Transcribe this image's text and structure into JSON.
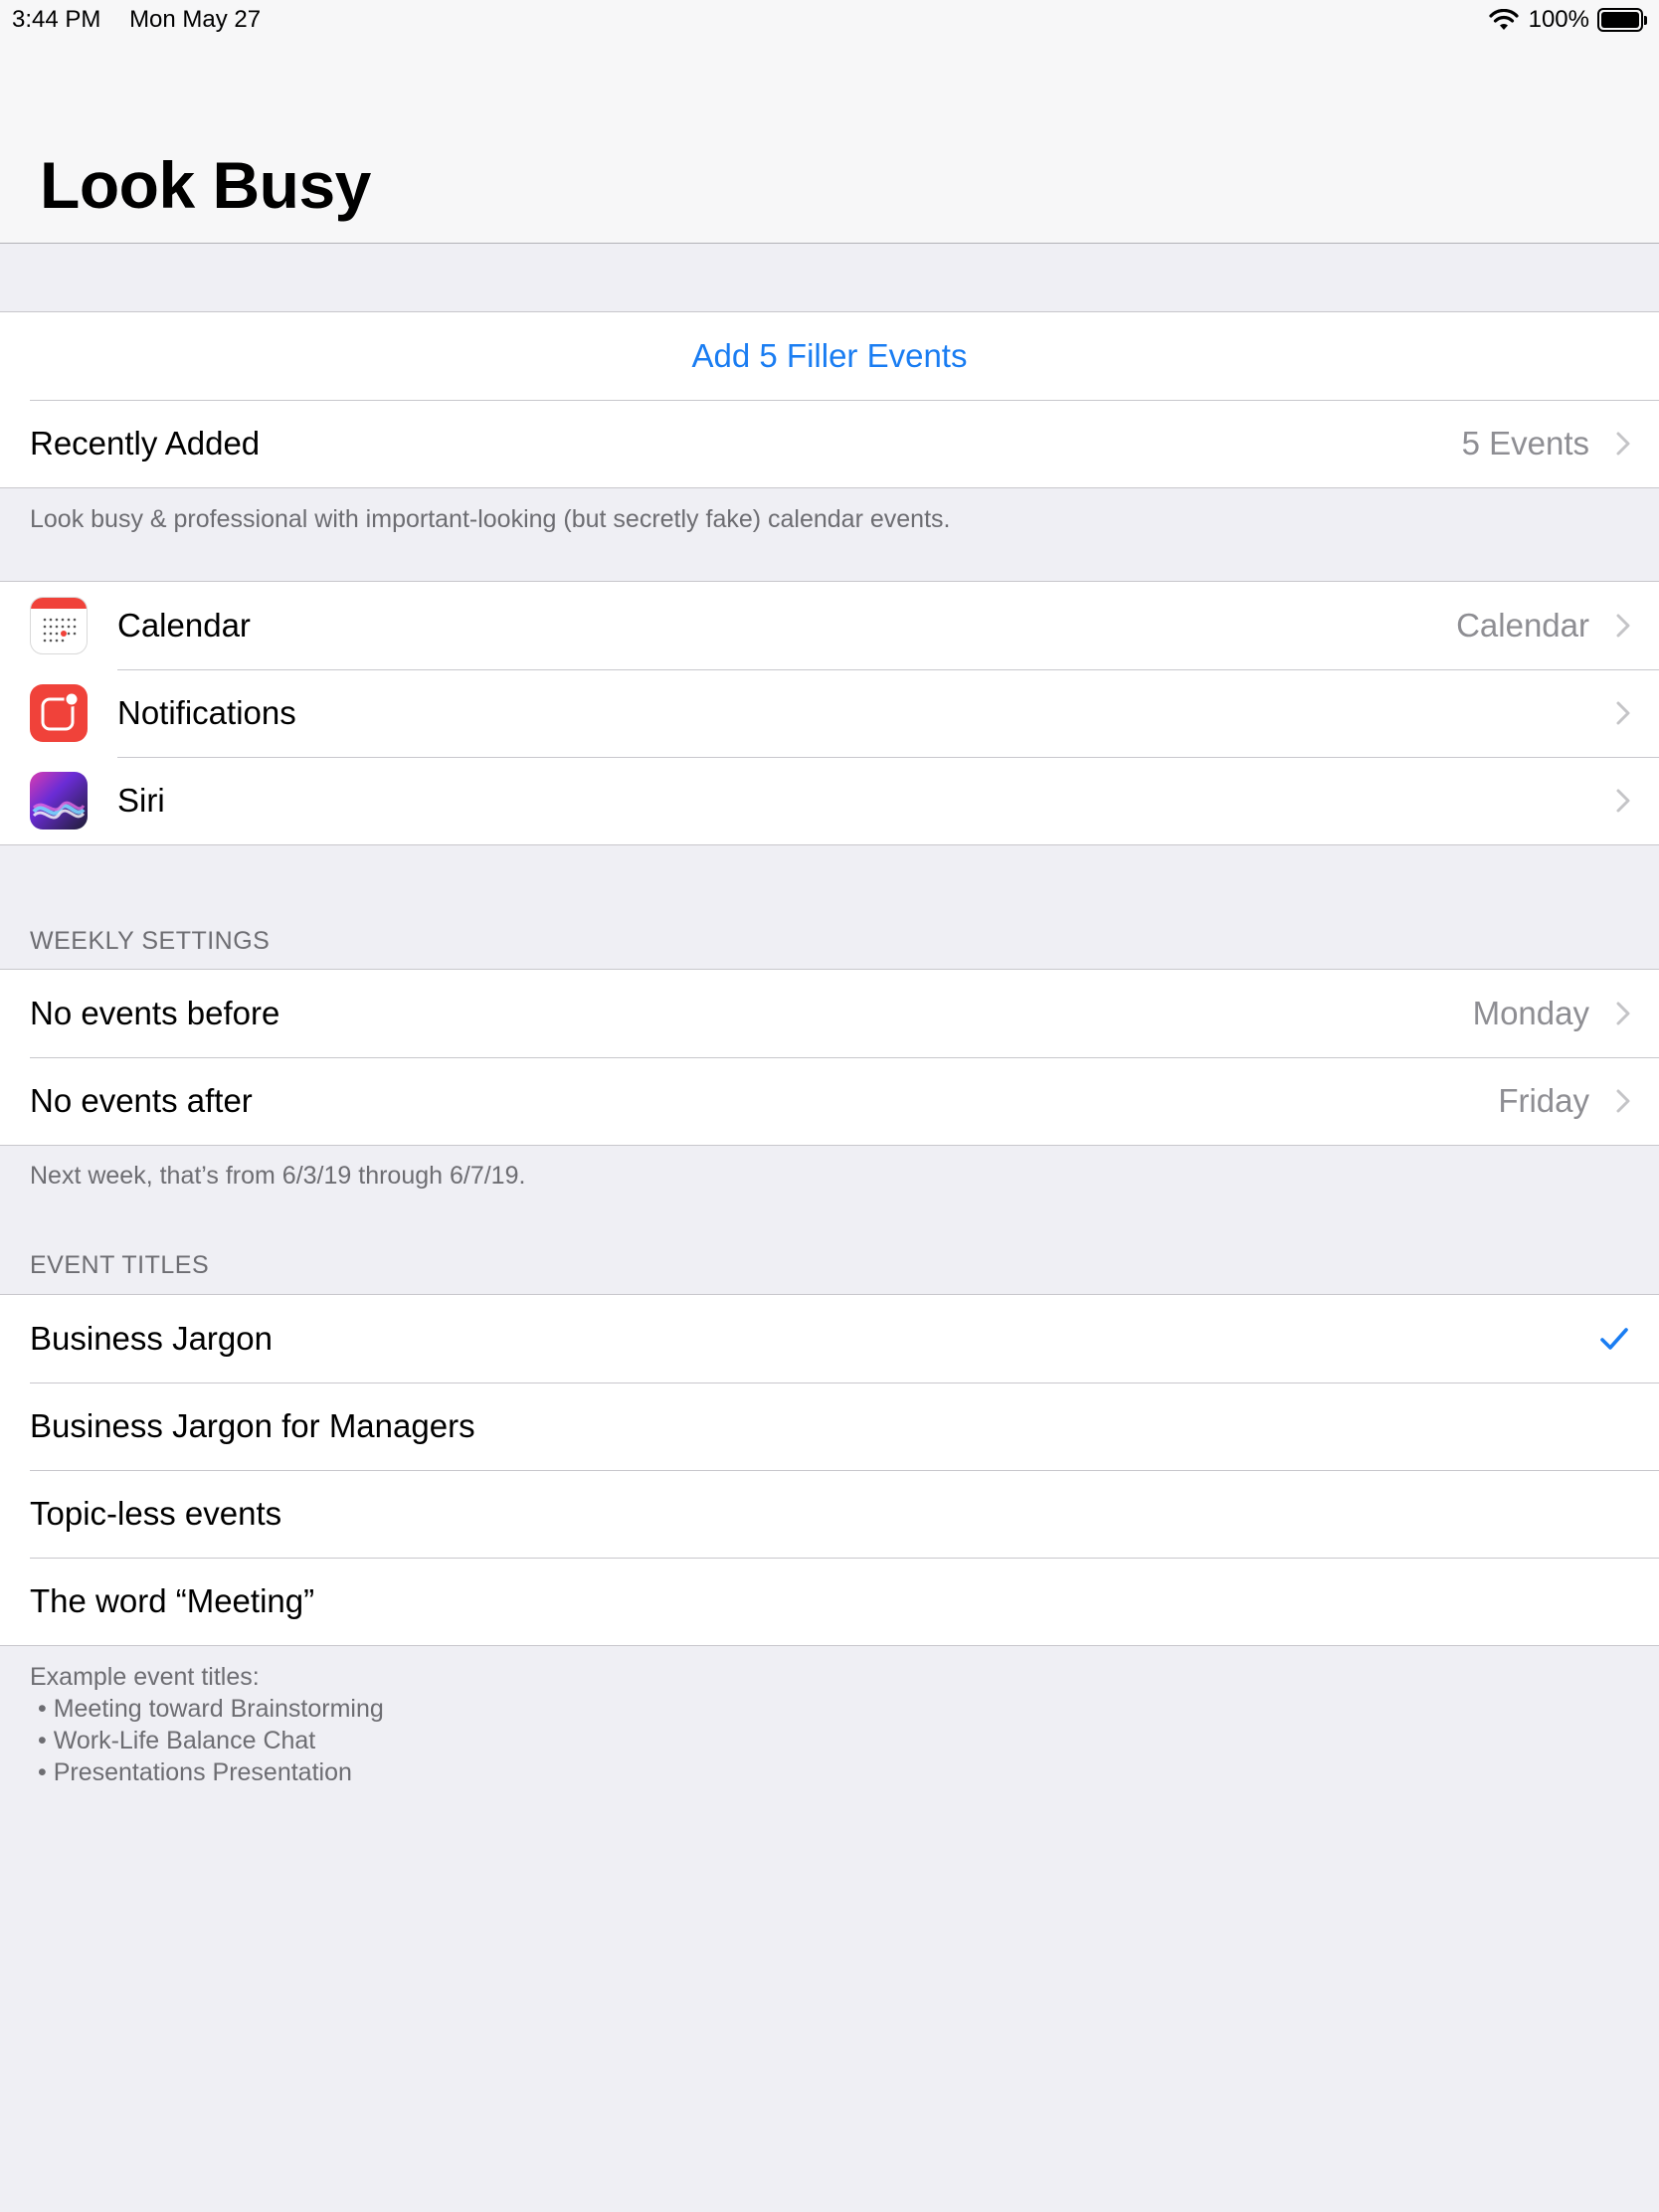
{
  "status_bar": {
    "time": "3:44 PM",
    "date": "Mon May 27",
    "battery": "100%"
  },
  "nav": {
    "title": "Look Busy"
  },
  "main_group": {
    "add_button": "Add 5 Filler Events",
    "recently_added_label": "Recently Added",
    "recently_added_value": "5 Events",
    "footer": "Look busy & professional with important-looking (but secretly fake) calendar events."
  },
  "permissions": {
    "calendar_label": "Calendar",
    "calendar_value": "Calendar",
    "notifications_label": "Notifications",
    "siri_label": "Siri"
  },
  "weekly": {
    "header": "WEEKLY SETTINGS",
    "before_label": "No events before",
    "before_value": "Monday",
    "after_label": "No events after",
    "after_value": "Friday",
    "footer": "Next week, that’s from 6/3/19 through 6/7/19."
  },
  "titles": {
    "header": "EVENT TITLES",
    "options": [
      "Business Jargon",
      "Business Jargon for Managers",
      "Topic-less events",
      "The word “Meeting”"
    ],
    "selected_index": 0,
    "footer_title": "Example event titles:",
    "examples": [
      "• Meeting toward Brainstorming",
      "• Work-Life Balance Chat",
      "• Presentations Presentation"
    ]
  },
  "colors": {
    "accent": "#1a7df2",
    "background": "#efeff4",
    "secondary_text": "#8e8e93"
  },
  "icons": [
    "wifi-icon",
    "battery-icon",
    "calendar-app-icon",
    "notifications-app-icon",
    "siri-app-icon",
    "chevron-right-icon",
    "checkmark-icon"
  ]
}
